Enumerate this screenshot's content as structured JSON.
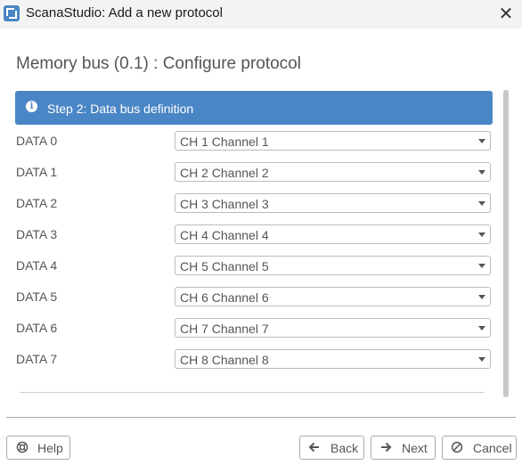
{
  "window": {
    "title": "ScanaStudio: Add a new protocol",
    "app_icon": "scanastudio-app-icon",
    "close_glyph": "✕"
  },
  "page": {
    "heading": "Memory bus (0.1) : Configure protocol"
  },
  "step": {
    "icon": "info-icon",
    "icon_glyph": "i",
    "label": "Step 2: Data bus definition",
    "banner_color": "#4a86c5"
  },
  "rows": [
    {
      "label": "DATA 0",
      "value": "CH 1 Channel 1"
    },
    {
      "label": "DATA 1",
      "value": "CH 2 Channel 2"
    },
    {
      "label": "DATA 2",
      "value": "CH 3 Channel 3"
    },
    {
      "label": "DATA 3",
      "value": "CH 4 Channel 4"
    },
    {
      "label": "DATA 4",
      "value": "CH 5 Channel 5"
    },
    {
      "label": "DATA 5",
      "value": "CH 6 Channel 6"
    },
    {
      "label": "DATA 6",
      "value": "CH 7 Channel 7"
    },
    {
      "label": "DATA 7",
      "value": "CH 8 Channel 8"
    }
  ],
  "footer": {
    "help_label": "Help",
    "help_icon": "lifebuoy-icon",
    "back_label": "Back",
    "back_icon": "arrow-left-icon",
    "next_label": "Next",
    "next_icon": "arrow-right-icon",
    "cancel_label": "Cancel",
    "cancel_icon": "cancel-icon"
  }
}
